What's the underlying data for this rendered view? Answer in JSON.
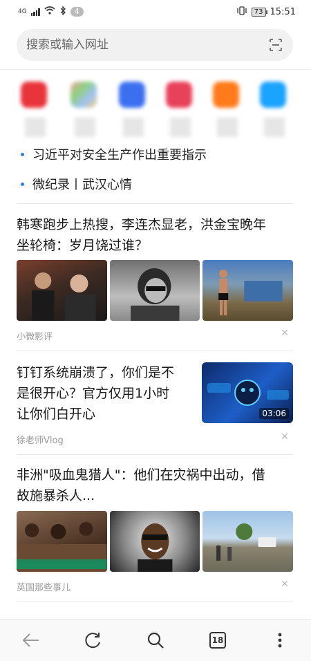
{
  "status": {
    "network": "4G",
    "notifications": "4",
    "battery": "73",
    "time": "15:51"
  },
  "search": {
    "placeholder": "搜索或输入网址"
  },
  "shortcut_colors": [
    "#e8343b",
    "#8fcf7a",
    "#3b6ff0",
    "#e8415a",
    "#ff7a1a",
    "#1aa3ff"
  ],
  "hot_list": [
    {
      "text": "习近平对安全生产作出重要指示"
    },
    {
      "text": "微纪录丨武汉心情"
    }
  ],
  "feeds": [
    {
      "title_line1": "韩寒跑步上热搜，李连杰显老，洪金宝晚年",
      "title_line2": "坐轮椅：岁月饶过谁？",
      "source": "小微影评"
    },
    {
      "title_line1": "钉钉系统崩溃了，你们是不",
      "title_line2": "是很开心？官方仅用1小时",
      "title_line3": "让你们白开心",
      "source": "徐老师Vlog",
      "video_duration": "03:06"
    },
    {
      "title_line1": "非洲\"吸血鬼猎人\"：他们在灾祸中出动，借",
      "title_line2": "故施暴杀人...",
      "source": "英国那些事儿"
    }
  ],
  "bottom_bar": {
    "tab_count": "18"
  },
  "colors": {
    "accent": "#2b7fe0"
  }
}
